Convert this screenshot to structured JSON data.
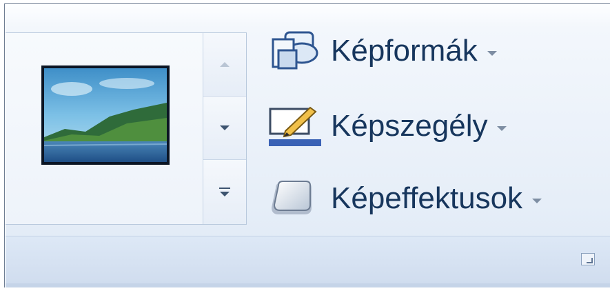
{
  "ribbon_group": {
    "commands": [
      {
        "label": "Képformák",
        "icon": "picture-shape-icon"
      },
      {
        "label": "Képszegély",
        "icon": "picture-border-icon"
      },
      {
        "label": "Képeffektusok",
        "icon": "picture-effects-icon"
      }
    ],
    "gallery": {
      "thumbnail": "landscape-picture-style",
      "scroll_icons": [
        "scroll-up-icon",
        "scroll-down-icon",
        "more-icon"
      ]
    },
    "dialog_launcher_icon": "dialog-launcher-icon"
  },
  "colors": {
    "label_text": "#17365d",
    "border_accent": "#3a62b5",
    "frame": "#6f7e93"
  }
}
